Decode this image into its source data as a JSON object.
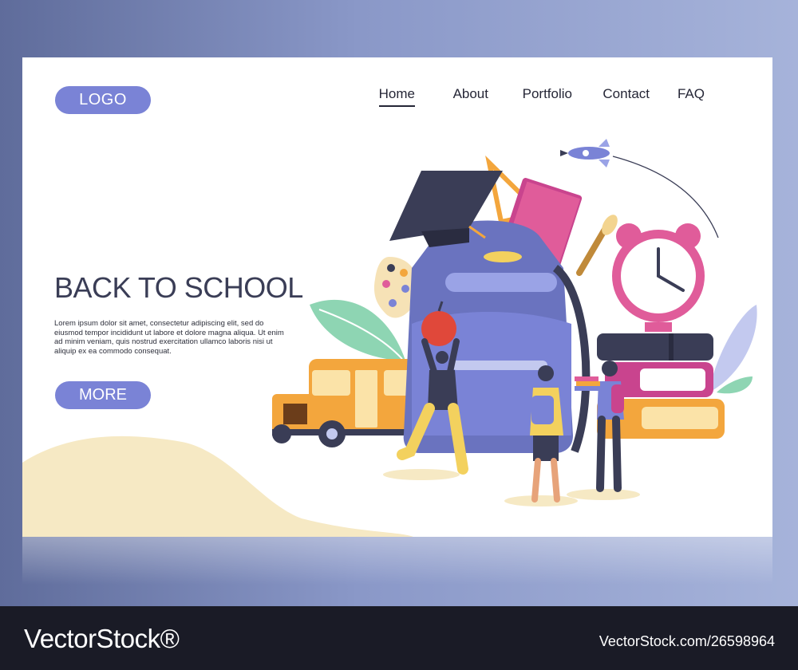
{
  "header": {
    "logo_label": "LOGO",
    "nav": [
      {
        "label": "Home",
        "active": true
      },
      {
        "label": "About",
        "active": false
      },
      {
        "label": "Portfolio",
        "active": false
      },
      {
        "label": "Contact",
        "active": false
      },
      {
        "label": "FAQ",
        "active": false
      }
    ]
  },
  "hero": {
    "title": "BACK TO SCHOOL",
    "body": "Lorem ipsum dolor sit amet, consectetur adipiscing elit, sed do eiusmod tempor incididunt ut labore et dolore magna aliqua. Ut enim ad minim veniam, quis nostrud exercitation ullamco laboris nisi ut aliquip ex ea commodo consequat.",
    "cta_label": "MORE"
  },
  "footer": {
    "brand": "VectorStock®",
    "image_id": "VectorStock.com/26598964"
  },
  "colors": {
    "accent": "#7a83d6",
    "background_outer": "#8a98c8",
    "page": "#ffffff",
    "text_dark": "#3a3d56",
    "footer": "#1a1b26",
    "sand": "#f6e9c4"
  },
  "illustration": {
    "icons": [
      "rocket-icon",
      "graduation-cap-icon",
      "backpack-icon",
      "alarm-clock-icon",
      "school-bus-icon",
      "paint-palette-icon",
      "books-icon",
      "apple-icon",
      "pencil-icon",
      "paintbrush-icon"
    ]
  }
}
